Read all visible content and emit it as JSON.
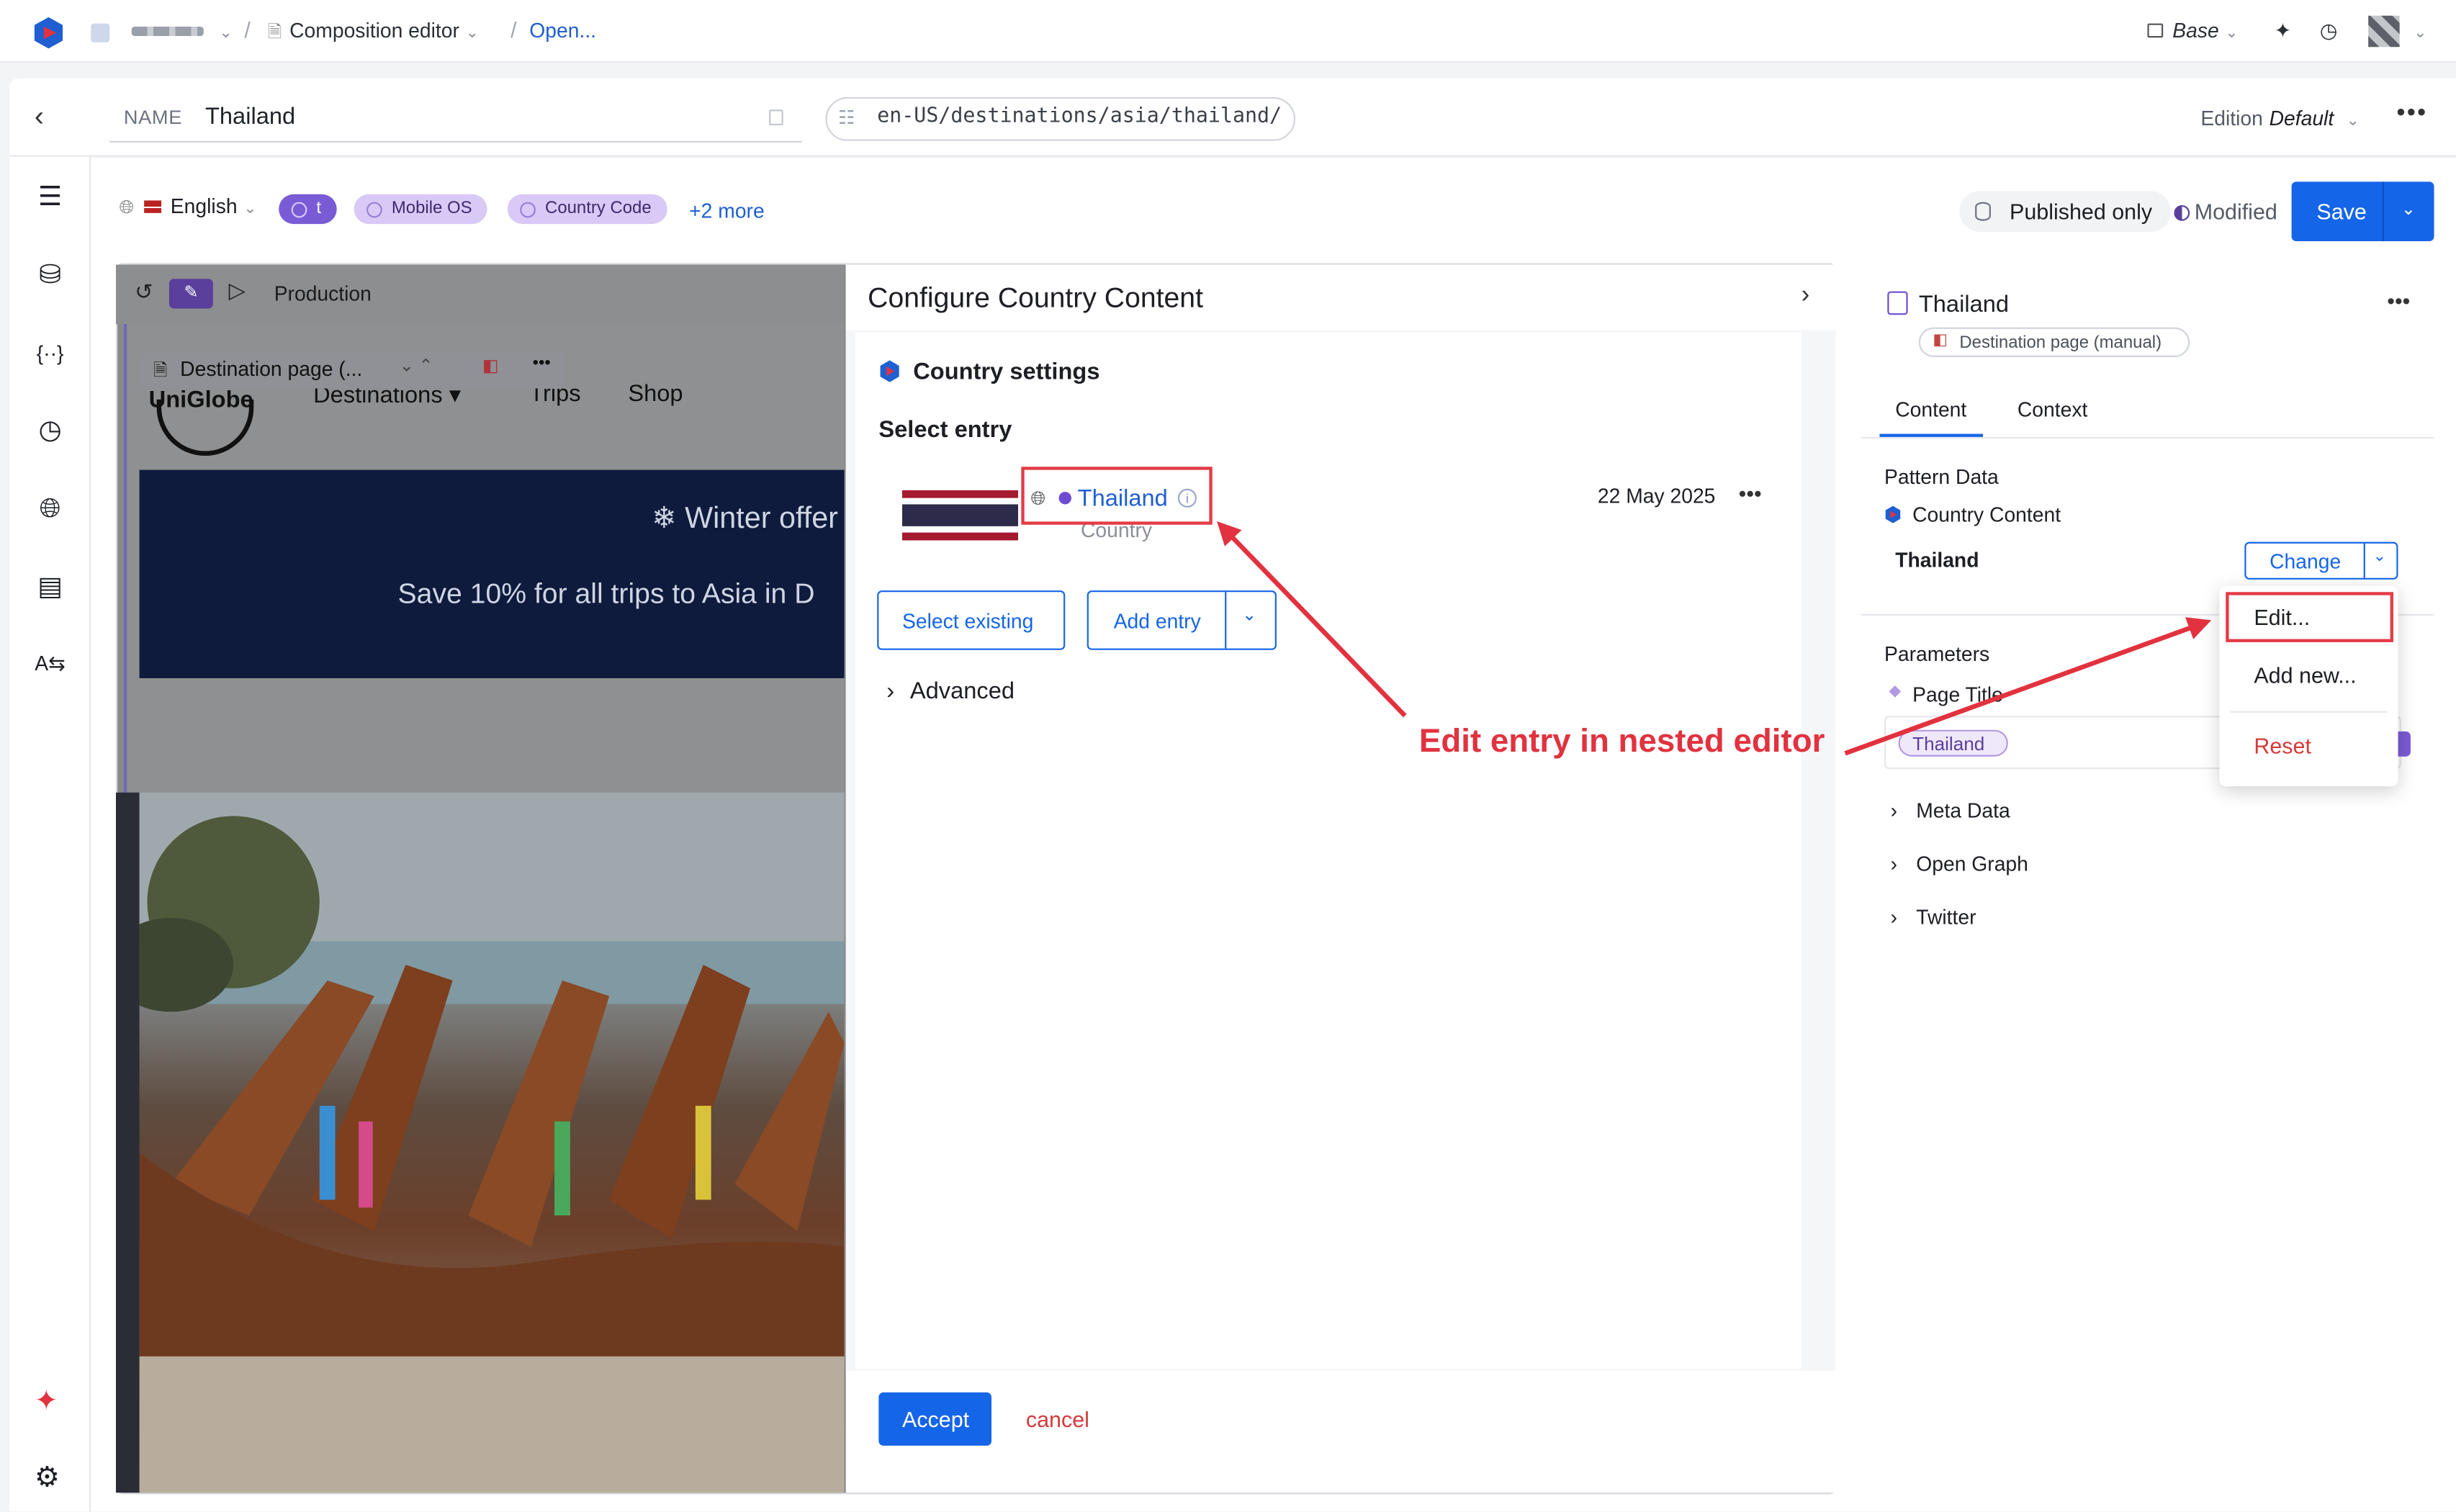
{
  "topbar": {
    "app_name": "Composition editor",
    "open_link": "Open...",
    "base_label": "Base"
  },
  "entry_header": {
    "name_label": "NAME",
    "name_value": "Thailand",
    "path": "en-US/destinations/asia/thailand/",
    "edition_label": "Edition",
    "edition_value": "Default"
  },
  "locale_bar": {
    "language": "English",
    "chips": [
      "t",
      "Mobile OS",
      "Country Code"
    ],
    "more": "+2 more",
    "published_only": "Published only",
    "modified": "Modified",
    "save": "Save"
  },
  "preview": {
    "environment": "Production",
    "component_label": "Destination page (...",
    "site_logo": "UniGlobe",
    "nav": [
      "Destinations",
      "Trips",
      "Shop"
    ],
    "hero_title": "Winter offer",
    "hero_text": "Save 10% for all trips to Asia in D"
  },
  "dialog": {
    "title": "Configure Country Content",
    "section_title": "Country settings",
    "select_entry_label": "Select entry",
    "entry": {
      "name": "Thailand",
      "type": "Country",
      "date": "22 May 2025"
    },
    "select_existing": "Select existing",
    "add_entry": "Add entry",
    "advanced": "Advanced",
    "accept": "Accept",
    "cancel": "cancel"
  },
  "right_panel": {
    "title": "Thailand",
    "type_chip": "Destination page (manual)",
    "tabs": [
      "Content",
      "Context"
    ],
    "pattern_data_label": "Pattern Data",
    "country_content_label": "Country Content",
    "selected_value": "Thailand",
    "change": "Change",
    "parameters_label": "Parameters",
    "page_title_label": "Page Title",
    "page_title_value": "Thailand",
    "groups": [
      "Meta Data",
      "Open Graph",
      "Twitter"
    ]
  },
  "change_menu": {
    "items": [
      "Edit...",
      "Add new...",
      "Reset"
    ]
  },
  "annotation": {
    "callout": "Edit entry in nested editor",
    "color": "#e2323f"
  }
}
